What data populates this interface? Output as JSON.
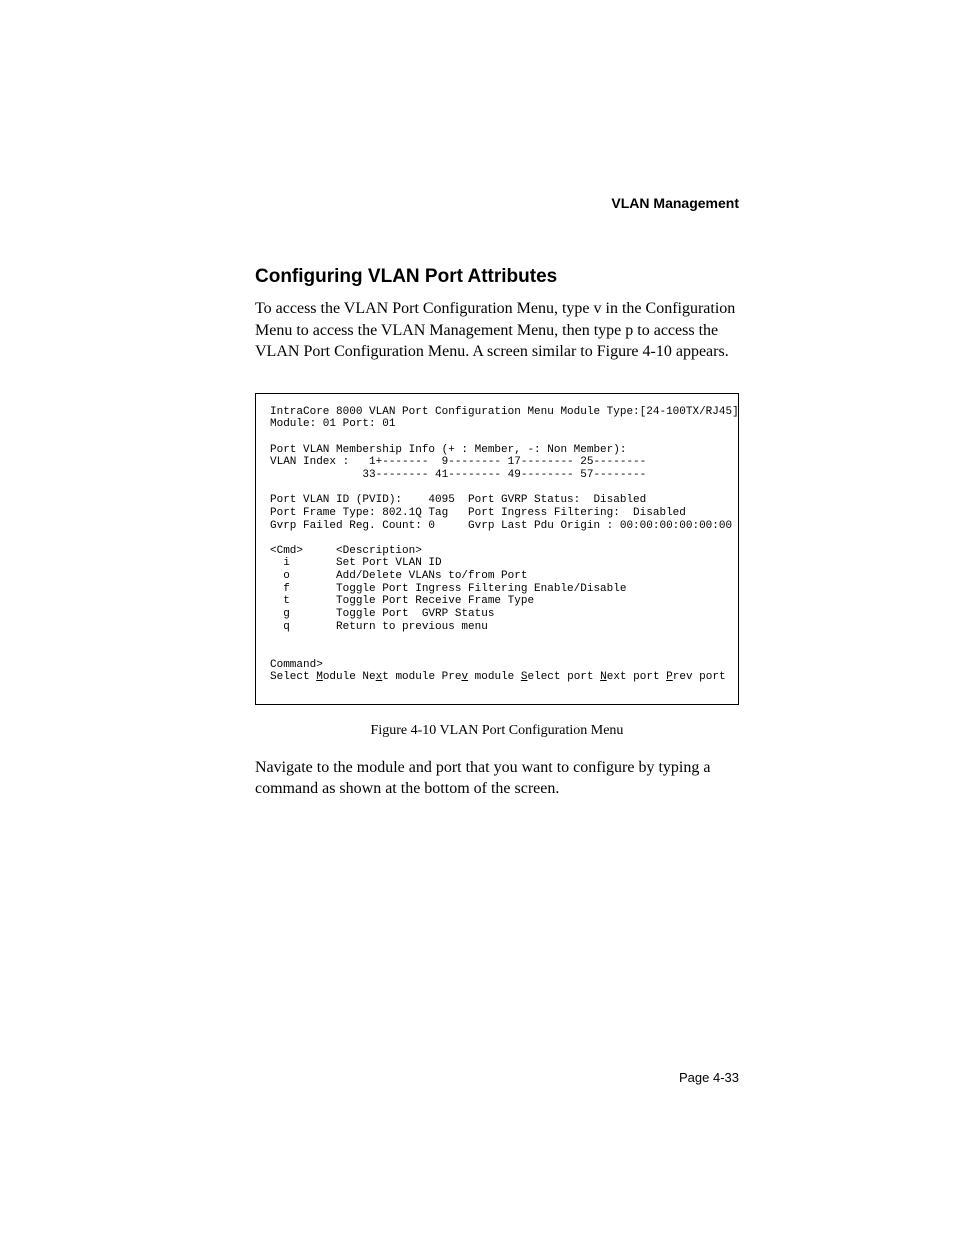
{
  "header": {
    "section_label": "VLAN Management"
  },
  "section": {
    "title": "Configuring VLAN Port Attributes",
    "intro": "To access the VLAN Port Configuration Menu, type v in the Configuration Menu to access the VLAN Management Menu, then type p to access the VLAN Port Configuration Menu. A screen similar to Figure 4-10 appears."
  },
  "terminal": {
    "line1": "IntraCore 8000 VLAN Port Configuration Menu Module Type:[24-100TX/RJ45]",
    "line2": "Module: 01 Port: 01",
    "blank1": "",
    "line3": "Port VLAN Membership Info (+ : Member, -: Non Member):",
    "line4": "VLAN Index :   1+-------  9-------- 17-------- 25--------",
    "line5": "              33-------- 41-------- 49-------- 57--------",
    "blank2": "",
    "line6": "Port VLAN ID (PVID):    4095  Port GVRP Status:  Disabled",
    "line7": "Port Frame Type: 802.1Q Tag   Port Ingress Filtering:  Disabled",
    "line8": "Gvrp Failed Reg. Count: 0     Gvrp Last Pdu Origin : 00:00:00:00:00:00",
    "blank3": "",
    "line9": "<Cmd>     <Description>",
    "line10": "  i       Set Port VLAN ID",
    "line11": "  o       Add/Delete VLANs to/from Port",
    "line12": "  f       Toggle Port Ingress Filtering Enable/Disable",
    "line13": "  t       Toggle Port Receive Frame Type",
    "line14": "  g       Toggle Port  GVRP Status",
    "line15": "  q       Return to previous menu",
    "blank4": "",
    "blank5": "",
    "line16": "Command>",
    "nav_select": "Select ",
    "nav_m": "M",
    "nav_odule": "odule Ne",
    "nav_x": "x",
    "nav_t_module": "t module Pre",
    "nav_v": "v",
    "nav_module_s": " module ",
    "nav_s": "S",
    "nav_elect_port": "elect port ",
    "nav_n": "N",
    "nav_ext_port": "ext port ",
    "nav_p": "P",
    "nav_rev_port": "rev port"
  },
  "figure": {
    "caption": "Figure 4-10   VLAN Port Configuration Menu"
  },
  "body2": "Navigate to the module and port that you want to configure by typing a command as shown at the bottom of the screen.",
  "footer": {
    "page_number": "Page 4-33"
  }
}
